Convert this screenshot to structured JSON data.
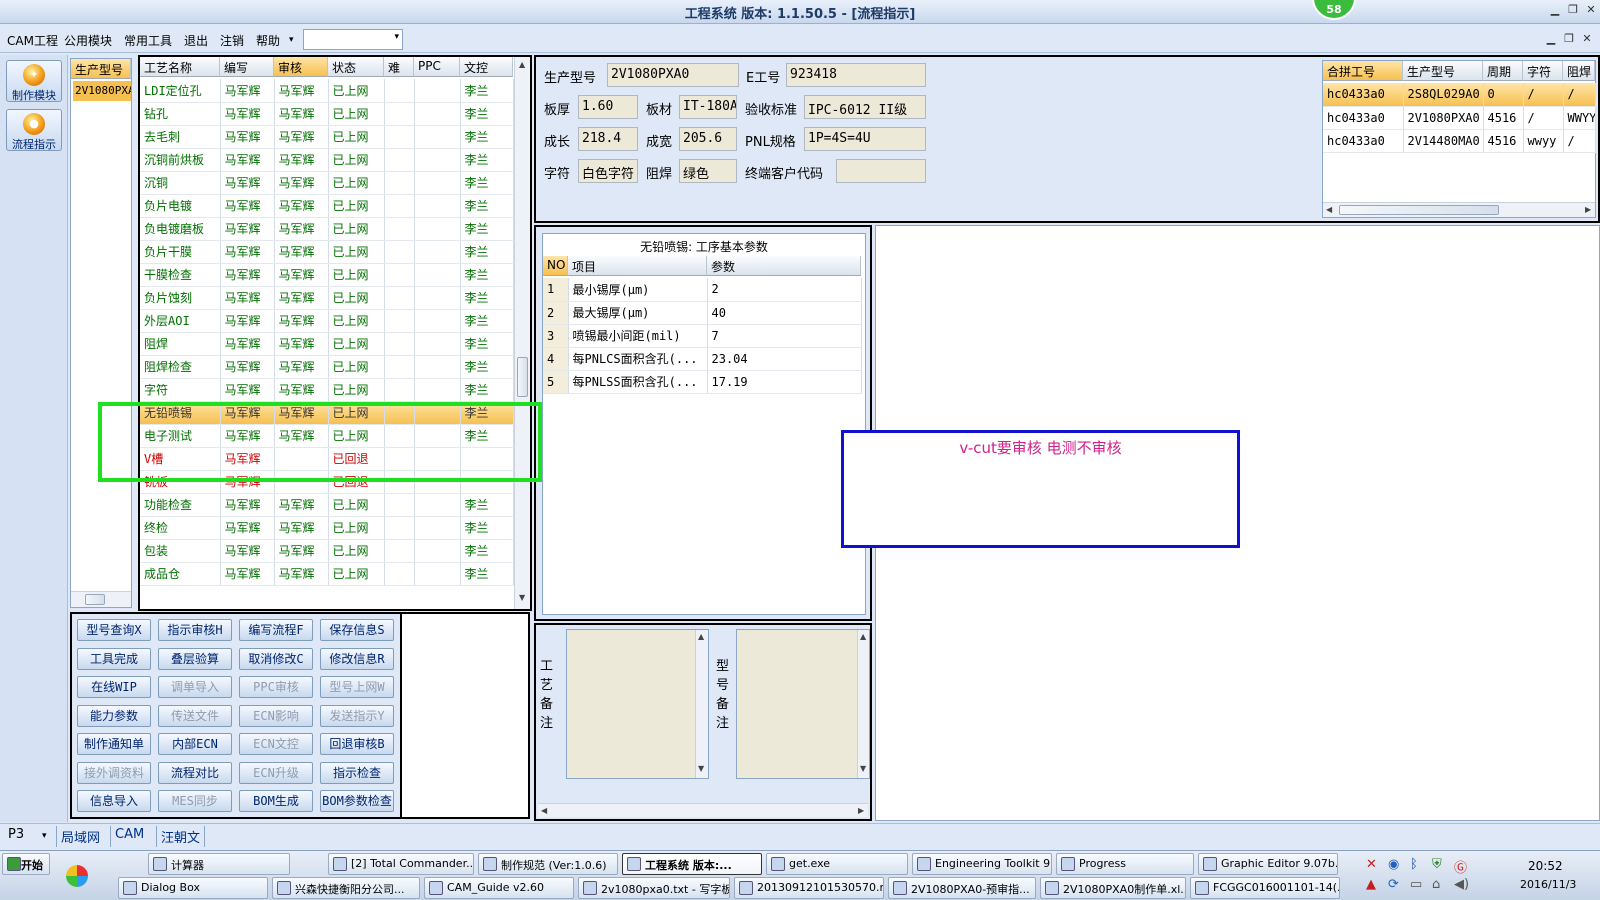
{
  "window": {
    "title": "工程系统  版本: 1.1.50.5 - [流程指示]",
    "notification_count": "58"
  },
  "menu": {
    "items": [
      "CAM工程",
      "公用模块",
      "常用工具",
      "退出",
      "注销",
      "帮助"
    ],
    "dropdown_arrow": "▾",
    "combo_value": ""
  },
  "side_buttons": [
    {
      "label": "制作模块",
      "icon": "flame-icon"
    },
    {
      "label": "流程指示",
      "icon": "orange-circle-icon"
    }
  ],
  "model_list": {
    "header": "生产型号",
    "items": [
      "2V1080PXA0"
    ]
  },
  "process_table": {
    "headers": [
      "工艺名称",
      "编写",
      "审核",
      "状态",
      "难",
      "PPC",
      "文控"
    ],
    "rows": [
      {
        "name": "LDI定位孔",
        "writer": "马军辉",
        "reviewer": "马军辉",
        "status": "已上网",
        "doc": "李兰",
        "style": "green"
      },
      {
        "name": "钻孔",
        "writer": "马军辉",
        "reviewer": "马军辉",
        "status": "已上网",
        "doc": "李兰",
        "style": "green"
      },
      {
        "name": "去毛刺",
        "writer": "马军辉",
        "reviewer": "马军辉",
        "status": "已上网",
        "doc": "李兰",
        "style": "green"
      },
      {
        "name": "沉铜前烘板",
        "writer": "马军辉",
        "reviewer": "马军辉",
        "status": "已上网",
        "doc": "李兰",
        "style": "green"
      },
      {
        "name": "沉铜",
        "writer": "马军辉",
        "reviewer": "马军辉",
        "status": "已上网",
        "doc": "李兰",
        "style": "green"
      },
      {
        "name": "负片电镀",
        "writer": "马军辉",
        "reviewer": "马军辉",
        "status": "已上网",
        "doc": "李兰",
        "style": "green"
      },
      {
        "name": "负电镀磨板",
        "writer": "马军辉",
        "reviewer": "马军辉",
        "status": "已上网",
        "doc": "李兰",
        "style": "green"
      },
      {
        "name": "负片干膜",
        "writer": "马军辉",
        "reviewer": "马军辉",
        "status": "已上网",
        "doc": "李兰",
        "style": "green"
      },
      {
        "name": "干膜检查",
        "writer": "马军辉",
        "reviewer": "马军辉",
        "status": "已上网",
        "doc": "李兰",
        "style": "green"
      },
      {
        "name": "负片蚀刻",
        "writer": "马军辉",
        "reviewer": "马军辉",
        "status": "已上网",
        "doc": "李兰",
        "style": "green"
      },
      {
        "name": "外层AOI",
        "writer": "马军辉",
        "reviewer": "马军辉",
        "status": "已上网",
        "doc": "李兰",
        "style": "green"
      },
      {
        "name": "阻焊",
        "writer": "马军辉",
        "reviewer": "马军辉",
        "status": "已上网",
        "doc": "李兰",
        "style": "green"
      },
      {
        "name": "阻焊检查",
        "writer": "马军辉",
        "reviewer": "马军辉",
        "status": "已上网",
        "doc": "李兰",
        "style": "green"
      },
      {
        "name": "字符",
        "writer": "马军辉",
        "reviewer": "马军辉",
        "status": "已上网",
        "doc": "李兰",
        "style": "green"
      },
      {
        "name": "无铅喷锡",
        "writer": "马军辉",
        "reviewer": "马军辉",
        "status": "已上网",
        "doc": "李兰",
        "style": "selected"
      },
      {
        "name": "电子测试",
        "writer": "马军辉",
        "reviewer": "马军辉",
        "status": "已上网",
        "doc": "李兰",
        "style": "green"
      },
      {
        "name": "V槽",
        "writer": "马军辉",
        "reviewer": "",
        "status": "已回退",
        "doc": "",
        "style": "red"
      },
      {
        "name": "铣板",
        "writer": "马军辉",
        "reviewer": "",
        "status": "已回退",
        "doc": "",
        "style": "red"
      },
      {
        "name": "功能检查",
        "writer": "马军辉",
        "reviewer": "马军辉",
        "status": "已上网",
        "doc": "李兰",
        "style": "green"
      },
      {
        "name": "终检",
        "writer": "马军辉",
        "reviewer": "马军辉",
        "status": "已上网",
        "doc": "李兰",
        "style": "green"
      },
      {
        "name": "包装",
        "writer": "马军辉",
        "reviewer": "马军辉",
        "status": "已上网",
        "doc": "李兰",
        "style": "green"
      },
      {
        "name": "成品仓",
        "writer": "马军辉",
        "reviewer": "马军辉",
        "status": "已上网",
        "doc": "李兰",
        "style": "green"
      }
    ]
  },
  "action_buttons": [
    {
      "label": "型号查询X",
      "enabled": true
    },
    {
      "label": "指示审核H",
      "enabled": true
    },
    {
      "label": "编写流程F",
      "enabled": true
    },
    {
      "label": "保存信息S",
      "enabled": true
    },
    {
      "label": "工具完成",
      "enabled": true
    },
    {
      "label": "叠层验算",
      "enabled": true
    },
    {
      "label": "取消修改C",
      "enabled": true
    },
    {
      "label": "修改信息R",
      "enabled": true
    },
    {
      "label": "在线WIP",
      "enabled": true
    },
    {
      "label": "调单导入",
      "enabled": false
    },
    {
      "label": "PPC审核",
      "enabled": false
    },
    {
      "label": "型号上网W",
      "enabled": false
    },
    {
      "label": "能力参数",
      "enabled": true
    },
    {
      "label": "传送文件",
      "enabled": false
    },
    {
      "label": "ECN影响",
      "enabled": false
    },
    {
      "label": "发送指示Y",
      "enabled": false
    },
    {
      "label": "制作通知单",
      "enabled": true
    },
    {
      "label": "内部ECN",
      "enabled": true
    },
    {
      "label": "ECN文控",
      "enabled": false
    },
    {
      "label": "回退审核B",
      "enabled": true
    },
    {
      "label": "接外调资料",
      "enabled": false
    },
    {
      "label": "流程对比",
      "enabled": true
    },
    {
      "label": "ECN升级",
      "enabled": false
    },
    {
      "label": "指示检查",
      "enabled": true
    },
    {
      "label": "信息导入",
      "enabled": true
    },
    {
      "label": "MES同步",
      "enabled": false
    },
    {
      "label": "BOM生成",
      "enabled": true
    },
    {
      "label": "BOM参数检查",
      "enabled": true
    }
  ],
  "info": {
    "model_label": "生产型号",
    "model_value": "2V1080PXA0",
    "eno_label": "E工号",
    "eno_value": "923418",
    "thickness_label": "板厚",
    "thickness_value": "1.60",
    "material_label": "板材",
    "material_value": "IT-180A",
    "standard_label": "验收标准",
    "standard_value": "IPC-6012 II级",
    "length_label": "成长",
    "length_value": "218.4",
    "width_label": "成宽",
    "width_value": "205.6",
    "pnl_label": "PNL规格",
    "pnl_value": "1P=4S=4U",
    "char_label": "字符",
    "char_value": "白色字符",
    "solder_label": "阻焊",
    "solder_value": "绿色",
    "customer_label": "终端客户代码",
    "customer_value": ""
  },
  "merge_table": {
    "headers": [
      "合拼工号",
      "生产型号",
      "周期",
      "字符",
      "阻焊"
    ],
    "rows": [
      [
        "hc0433a0",
        "2S8QL029A0",
        "0",
        "/",
        "/"
      ],
      [
        "hc0433a0",
        "2V1080PXA0",
        "4516",
        "/",
        "WWYY"
      ],
      [
        "hc0433a0",
        "2V14480MA0",
        "4516",
        "wwyy",
        "/"
      ]
    ]
  },
  "params": {
    "title": "无铅喷锡: 工序基本参数",
    "headers": [
      "NO",
      "项目",
      "参数"
    ],
    "rows": [
      [
        "1",
        "最小锡厚(μm)",
        "2"
      ],
      [
        "2",
        "最大锡厚(μm)",
        "40"
      ],
      [
        "3",
        "喷锡最小间距(mil)",
        "7"
      ],
      [
        "4",
        "每PNLCS面积含孔(...",
        "23.04"
      ],
      [
        "5",
        "每PNLSS面积含孔(...",
        "17.19"
      ]
    ]
  },
  "notes": {
    "process_label": "工艺备注",
    "model_label": "型号备注"
  },
  "annotation": {
    "text": "v-cut要审核   电测不审核",
    "color": "#d0208a"
  },
  "bottom_tabs": {
    "left_label": "P3",
    "tabs": [
      "局域网",
      "CAM",
      "汪朝文"
    ]
  },
  "taskbar": {
    "start": "开始",
    "row1": [
      "计算器",
      "[2] Total Commander...",
      "制作规范 (Ver:1.0.6)",
      "工程系统  版本:...",
      "get.exe",
      "Engineering Toolkit 9....",
      "Progress",
      "Graphic Editor 9.07b..."
    ],
    "row2": [
      "Dialog Box",
      "兴森快捷衡阳分公司...",
      "CAM_Guide v2.60",
      "2v1080pxa0.txt - 写字板",
      "20130912101530570.r...",
      "2V1080PXA0-预审指...",
      "2V1080PXA0制作单.xl...",
      "FCGGC016001101-14(..."
    ],
    "time": "20:52",
    "date": "2016/11/3"
  },
  "colors": {
    "accent": "#1ee01e",
    "selected_row": "#f6c050",
    "green_text": "#007000",
    "red_text": "#d00000"
  }
}
